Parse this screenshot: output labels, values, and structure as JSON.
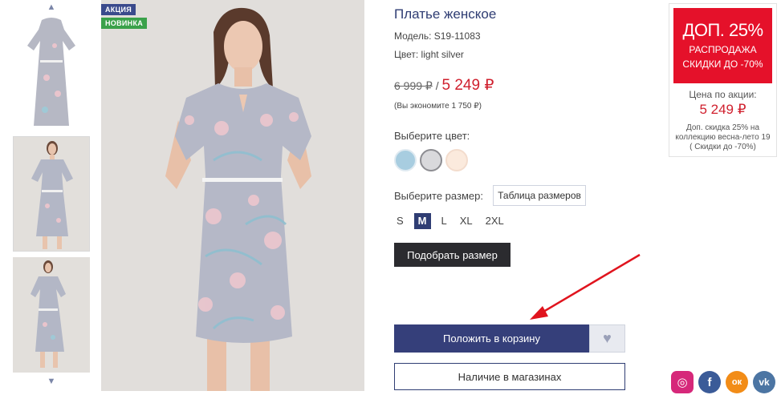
{
  "badges": {
    "sale": "АКЦИЯ",
    "new": "НОВИНКА"
  },
  "thumbnails": {
    "up_icon": "chevron-up-icon",
    "down_icon": "chevron-down-icon",
    "count": 3
  },
  "product": {
    "title": "Платье женское",
    "model": "Модель: S19-11083",
    "color": "Цвет: light silver",
    "old_price": "6 999 ₽",
    "price_sep": " / ",
    "new_price": "5 249 ₽",
    "savings": "(Вы экономите 1 750 ₽)"
  },
  "color_select": {
    "label": "Выберите цвет:",
    "options": [
      "#a8cde0",
      "#d9d9dc",
      "#fbeadd"
    ],
    "selected_index": 1
  },
  "size_select": {
    "label": "Выберите размер:",
    "size_table": "Таблица размеров",
    "sizes": [
      "S",
      "M",
      "L",
      "XL",
      "2XL"
    ],
    "selected": "M"
  },
  "buttons": {
    "pick_size": "Подобрать размер",
    "add_to_cart": "Положить в корзину",
    "favorite_icon": "heart-icon",
    "in_stores": "Наличие в магазинах"
  },
  "promo": {
    "headline": "ДОП. 25%",
    "line1": "РАСПРОДАЖА",
    "line2": "СКИДКИ ДО -70%",
    "price_label": "Цена по акции:",
    "price": "5 249 ₽",
    "note": "Доп. скидка 25% на коллекцию весна-лето 19 ( Скидки до -70%)"
  },
  "social": [
    {
      "name": "instagram-icon",
      "glyph": "◎"
    },
    {
      "name": "facebook-icon",
      "glyph": "f"
    },
    {
      "name": "odnoklassniki-icon",
      "glyph": "ок"
    },
    {
      "name": "vk-icon",
      "glyph": "vk"
    }
  ],
  "colors": {
    "accent": "#2f3d73",
    "price_red": "#d0202e",
    "promo_red": "#e5112a"
  }
}
